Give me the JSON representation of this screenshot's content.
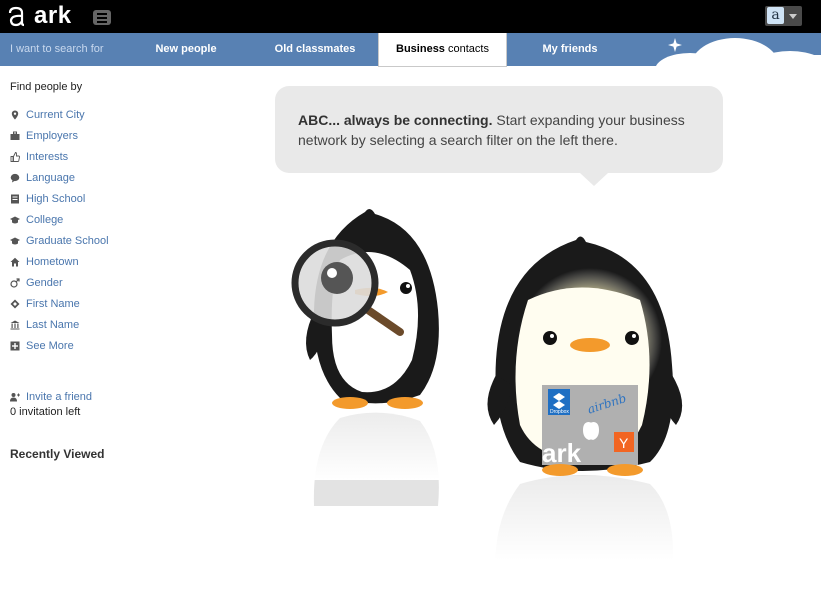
{
  "app": {
    "brand": "ark",
    "colors": {
      "topbar": "#000000",
      "navbar": "#5881b3",
      "link": "#4a76ad",
      "bubble": "#e9e9e9"
    }
  },
  "nav": {
    "search_label": "I want to search for",
    "tabs": [
      {
        "bold": "New people",
        "light": ""
      },
      {
        "bold": "Old classmates",
        "light": ""
      },
      {
        "bold": "Business",
        "light": " contacts"
      },
      {
        "bold": "My friends",
        "light": ""
      }
    ],
    "active_tab": 2
  },
  "sidebar": {
    "heading": "Find people by",
    "filters": [
      {
        "label": "Current City",
        "icon": "location-pin-icon"
      },
      {
        "label": "Employers",
        "icon": "briefcase-icon"
      },
      {
        "label": "Interests",
        "icon": "thumbs-up-icon"
      },
      {
        "label": "Language",
        "icon": "speech-icon"
      },
      {
        "label": "High School",
        "icon": "book-icon"
      },
      {
        "label": "College",
        "icon": "graduation-cap-icon"
      },
      {
        "label": "Graduate School",
        "icon": "graduation-cap-icon"
      },
      {
        "label": "Hometown",
        "icon": "house-icon"
      },
      {
        "label": "Gender",
        "icon": "male-symbol-icon"
      },
      {
        "label": "First Name",
        "icon": "diamond-icon"
      },
      {
        "label": "Last Name",
        "icon": "bank-icon"
      },
      {
        "label": "See More",
        "icon": "plus-box-icon"
      }
    ],
    "invite_label": "Invite a friend",
    "invite_count": "0 invitation left",
    "recently_viewed": "Recently Viewed"
  },
  "main": {
    "bubble_bold": "ABC... always be connecting.",
    "bubble_text": " Start expanding your business network by selecting a search filter on the left there.",
    "sign_logos": {
      "dropbox": "Dropbox",
      "airbnb": "airbnb",
      "ark": "ark",
      "ycombinator": "Y"
    }
  }
}
